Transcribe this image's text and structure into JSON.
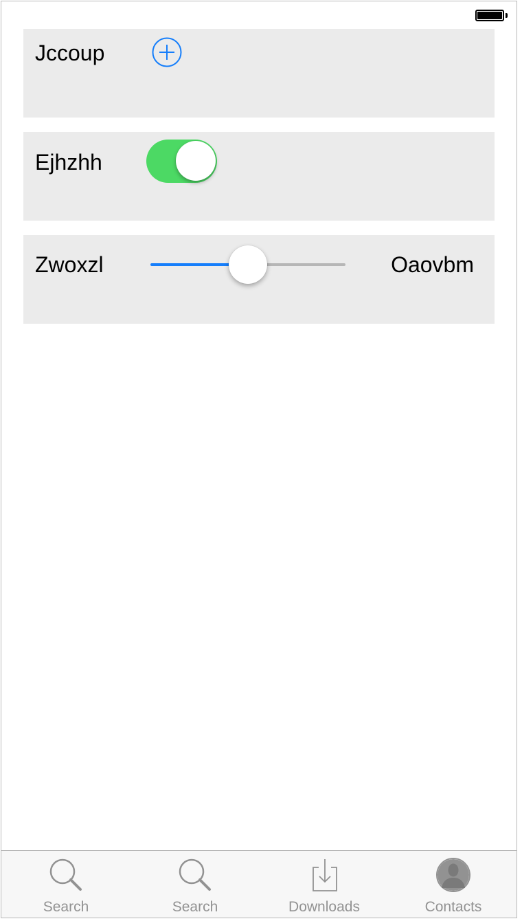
{
  "colors": {
    "accent": "#157efb",
    "toggle_on": "#4cd964",
    "card_background": "#ebebeb",
    "tab_inactive": "#929292"
  },
  "rows": [
    {
      "label": "Jccoup",
      "control": "add-button",
      "icon": "plus-circle-icon"
    },
    {
      "label": "Ejhzhh",
      "control": "toggle",
      "on": true
    },
    {
      "label": "Zwoxzl",
      "control": "slider",
      "value": 0.5,
      "max_label": "Oaovbm"
    }
  ],
  "tabs": [
    {
      "label": "Search",
      "icon": "search-icon"
    },
    {
      "label": "Search",
      "icon": "search-icon"
    },
    {
      "label": "Downloads",
      "icon": "download-icon"
    },
    {
      "label": "Contacts",
      "icon": "contact-icon"
    }
  ],
  "status": {
    "battery_level": 1.0
  }
}
